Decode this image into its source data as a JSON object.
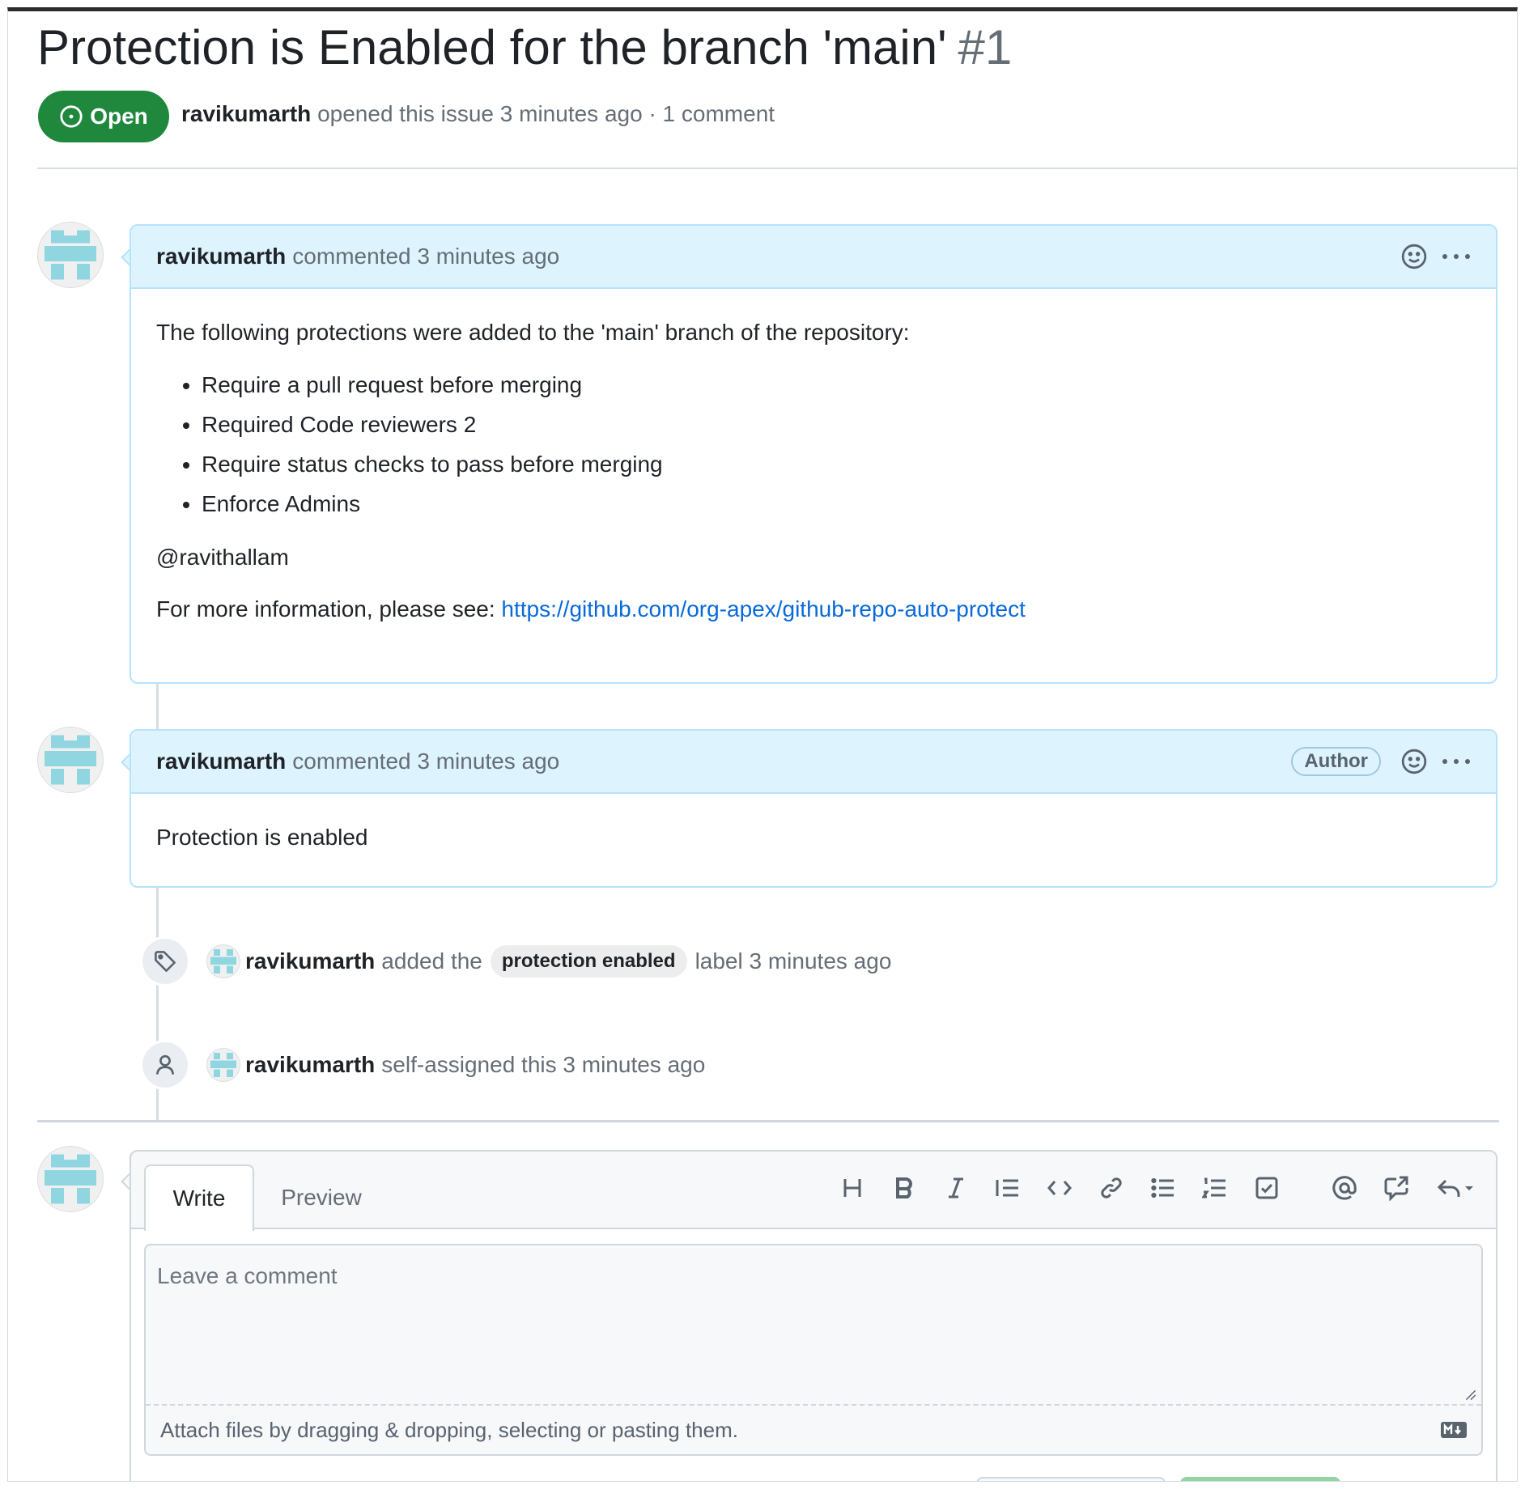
{
  "issue": {
    "title": "Protection is Enabled for the branch 'main'",
    "number": "#1",
    "state": "Open",
    "author": "ravikumarth",
    "meta_text": "opened this issue 3 minutes ago · 1 comment"
  },
  "comments": [
    {
      "author": "ravikumarth",
      "action": "commented 3 minutes ago",
      "intro": "The following protections were added to the 'main' branch of the repository:",
      "items": [
        "Require a pull request before merging",
        "Required Code reviewers 2",
        "Require status checks to pass before merging",
        "Enforce Admins"
      ],
      "mention": "@ravithallam",
      "info_prefix": "For more information, please see: ",
      "info_link": "https://github.com/org-apex/github-repo-auto-protect"
    },
    {
      "author": "ravikumarth",
      "action": "commented 3 minutes ago",
      "badge": "Author",
      "body": "Protection is enabled"
    }
  ],
  "events": [
    {
      "icon": "tag-icon",
      "actor": "ravikumarth",
      "pre": "added the",
      "label": "protection enabled",
      "post": "label 3 minutes ago"
    },
    {
      "icon": "person-icon",
      "actor": "ravikumarth",
      "text": "self-assigned this 3 minutes ago"
    }
  ],
  "editor": {
    "tabs": [
      "Write",
      "Preview"
    ],
    "toolbar_icons": [
      "heading-icon",
      "bold-icon",
      "italic-icon",
      "quote-icon",
      "code-icon",
      "link-icon",
      "unordered-list-icon",
      "ordered-list-icon",
      "task-list-icon",
      "mention-icon",
      "reference-icon",
      "saved-replies-icon"
    ],
    "placeholder": "Leave a comment",
    "attach_hint": "Attach files by dragging & dropping, selecting or pasting them."
  },
  "colors": {
    "open_green": "#1f883d",
    "comment_header_bg": "#ddf4ff",
    "comment_border": "#b6e3ff",
    "link_blue": "#0969da"
  }
}
